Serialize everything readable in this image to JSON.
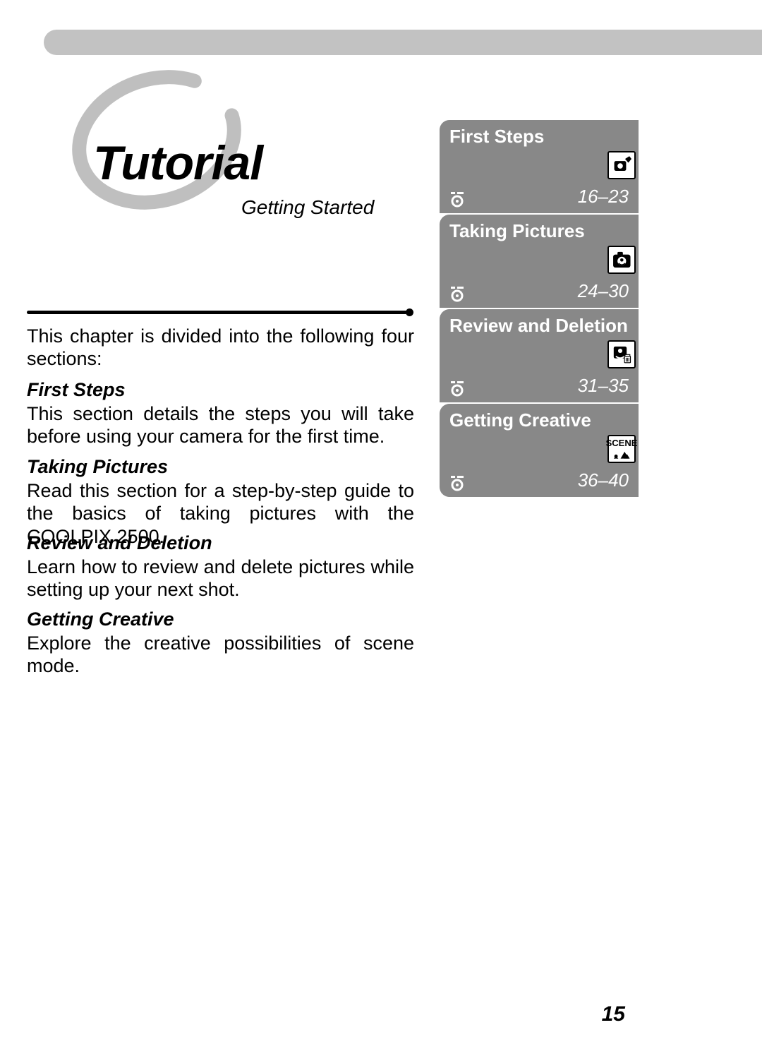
{
  "header": {
    "title": "Tutorial",
    "subtitle": "Getting Started"
  },
  "intro": "This chapter is divided into the following four sec­tions:",
  "sections": [
    {
      "heading": "First Steps",
      "body": "This section details the steps you will take before using your camera for the first time."
    },
    {
      "heading": "Taking Pictures",
      "body": "Read this section for a step-by-step guide to the basics of taking pictures with the COOLPIX 2500."
    },
    {
      "heading": "Review and Deletion",
      "body": "Learn how to review and delete pictures while set­ting up your next shot."
    },
    {
      "heading": "Getting Creative",
      "body": "Explore the creative possibilities of scene mode."
    }
  ],
  "sidebar": [
    {
      "title": "First Steps",
      "pages": "16–23",
      "icon": "camera-hand-icon"
    },
    {
      "title": "Taking Pictures",
      "pages": "24–30",
      "icon": "camera-face-icon"
    },
    {
      "title": "Review and Deletion",
      "pages": "31–35",
      "icon": "delete-photo-icon"
    },
    {
      "title": "Getting Creative",
      "pages": "36–40",
      "icon": "scene-icon",
      "scene_label": "SCENE"
    }
  ],
  "page_number": "15"
}
